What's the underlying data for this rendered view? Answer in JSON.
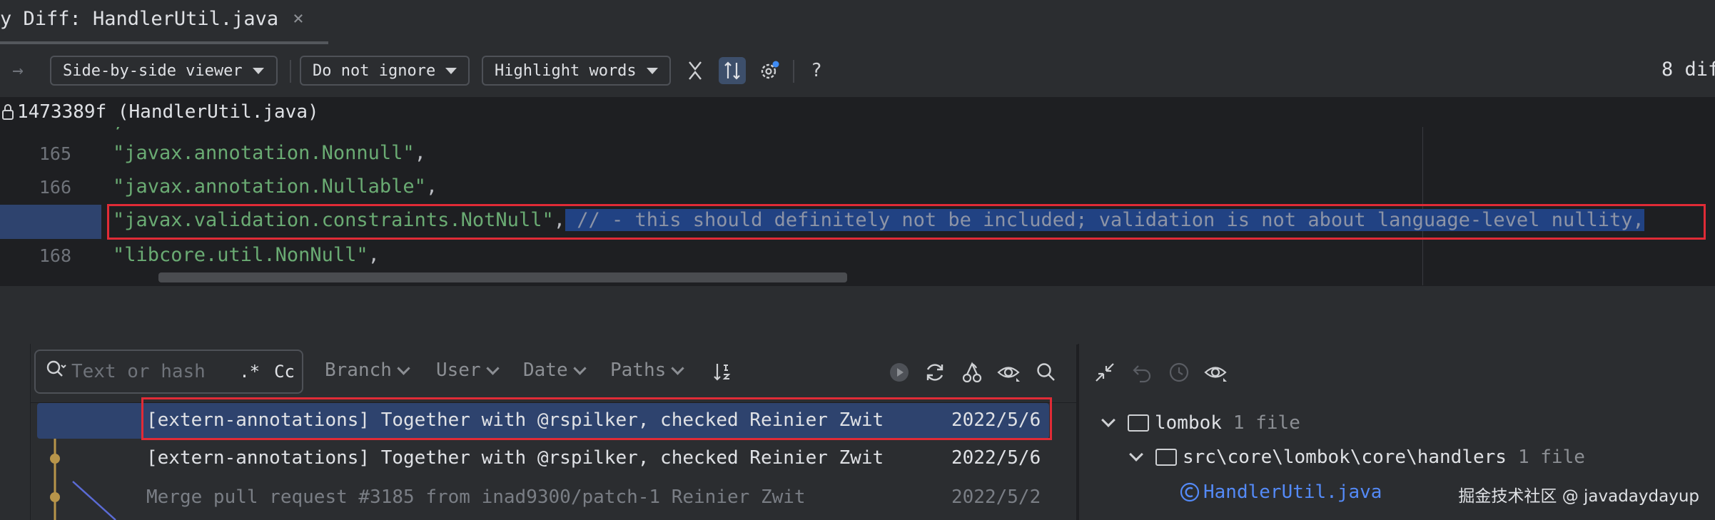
{
  "tab": {
    "title": "y Diff: HandlerUtil.java",
    "close": "×"
  },
  "toolbar": {
    "forward_arrow": "→",
    "viewer": "Side-by-side viewer",
    "ignore": "Do not ignore",
    "highlight": "Highlight words",
    "help": "?",
    "diff_count": "8 dif"
  },
  "revision": {
    "label": "1473389f (HandlerUtil.java)"
  },
  "editor": {
    "lines": [
      {
        "num": "165",
        "str": "\"javax.annotation.Nonnull\"",
        "punc": ",",
        "comment": ""
      },
      {
        "num": "166",
        "str": "\"javax.annotation.Nullable\"",
        "punc": ",",
        "comment": ""
      },
      {
        "num": "",
        "str": "\"javax.validation.constraints.NotNull\"",
        "punc": ",",
        "comment": " // - this should definitely not be included; validation is not about language-level nullity,"
      },
      {
        "num": "168",
        "str": "\"libcore.util.NonNull\"",
        "punc": ",",
        "comment": ""
      }
    ]
  },
  "log": {
    "search_placeholder": "Text or hash",
    "regex": ".*",
    "case": "Cc",
    "filters": [
      "Branch",
      "User",
      "Date",
      "Paths"
    ],
    "commits": [
      {
        "message": "[extern-annotations] Together with @rspilker, checked",
        "author": "Reinier Zwit",
        "date": "2022/5/6"
      },
      {
        "message": "[extern-annotations] Together with @rspilker, checked",
        "author": "Reinier Zwit",
        "date": "2022/5/6"
      },
      {
        "message": "Merge pull request #3185 from inad9300/patch-1",
        "author": "Reinier Zwit",
        "date": "2022/5/2"
      }
    ]
  },
  "files": {
    "root": {
      "name": "lombok",
      "count": "1 file"
    },
    "folder": {
      "name": "src\\core\\lombok\\core\\handlers",
      "count": "1 file"
    },
    "file": {
      "name": "HandlerUtil.java"
    }
  },
  "watermark": "掘金技术社区 @ javadaydayup",
  "colors": {
    "highlight_border": "#e02b36",
    "selection": "#2e436e",
    "string": "#6aab73",
    "comment": "#7a7e85"
  }
}
